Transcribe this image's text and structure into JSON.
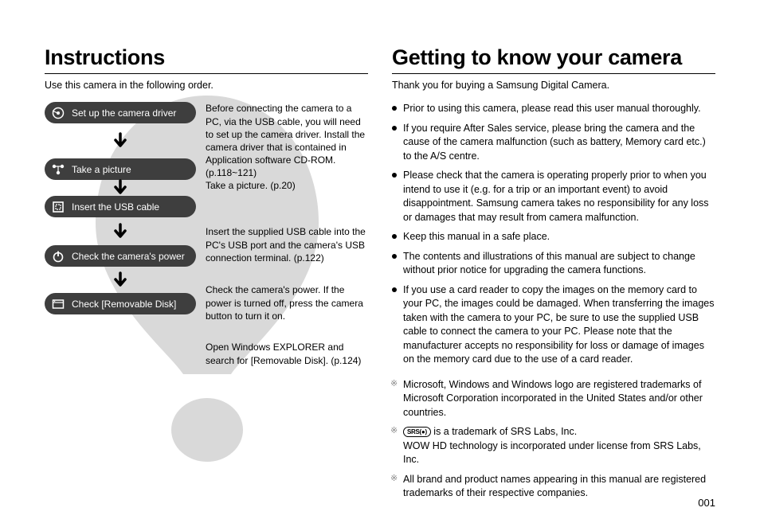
{
  "page_number": "001",
  "left": {
    "heading": "Instructions",
    "intro": "Use this camera in the following order.",
    "steps": [
      {
        "label": "Set up the camera driver",
        "icon": "disc-icon",
        "desc": "Before connecting the camera to a PC, via the USB cable, you will need to set up the camera driver. Install the camera driver that is contained in Application software CD-ROM. (p.118~121)"
      },
      {
        "label": "Take a picture",
        "icon": "nodes-icon",
        "desc": "Take a picture. (p.20)"
      },
      {
        "label": "Insert the USB cable",
        "icon": "square-outline-icon",
        "desc": "Insert the supplied USB cable into the PC's USB port and the camera's USB connection terminal. (p.122)"
      },
      {
        "label": "Check the camera's power",
        "icon": "power-icon",
        "desc": "Check the camera's power. If the power is turned off, press the camera button to turn it on."
      },
      {
        "label": "Check [Removable Disk]",
        "icon": "window-icon",
        "desc": "Open Windows EXPLORER and search for [Removable Disk]. (p.124)"
      }
    ]
  },
  "right": {
    "heading": "Getting to know your camera",
    "intro": "Thank you for buying a Samsung Digital Camera.",
    "bullets": [
      "Prior to using this camera, please read this user manual thoroughly.",
      "If you require After Sales service, please bring the camera and the cause of the camera malfunction (such as battery, Memory card etc.) to the A/S centre.",
      "Please check that the camera is operating properly prior to when you intend to use it (e.g. for a trip or an important event) to avoid disappointment. Samsung camera takes no responsibility for any loss or damages that may result from camera malfunction.",
      "Keep this manual in a safe place.",
      "The contents and illustrations of this manual are subject to change without prior notice for upgrading the camera functions.",
      "If you use a card reader to copy the images on the memory card to your PC, the images could be damaged. When transferring the images taken with the camera to your PC, be sure to use the supplied USB cable to connect the camera to your PC. Please note that the manufacturer accepts no responsibility for loss or damage of images on the memory card due to the use of a card reader."
    ],
    "trademarks": {
      "ms": "Microsoft, Windows and Windows logo are registered trademarks of Microsoft Corporation incorporated in the United States and/or other countries.",
      "srs_badge": "SRS(●)",
      "srs_suffix": " is a trademark of SRS Labs, Inc.",
      "srs_line2": "WOW HD technology is incorporated under license from SRS Labs, Inc.",
      "brands": "All brand and product names appearing in this manual are registered trademarks of their respective companies."
    }
  }
}
